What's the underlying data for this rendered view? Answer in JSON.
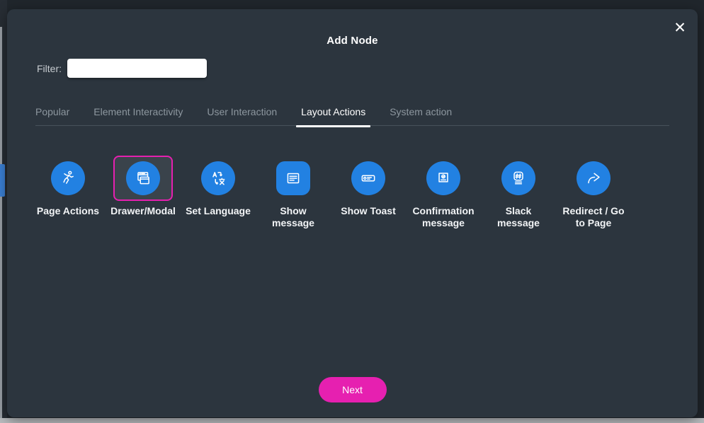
{
  "modal": {
    "title": "Add Node",
    "close_glyph": "✕",
    "filter": {
      "label": "Filter:",
      "value": "",
      "placeholder": ""
    },
    "tabs": [
      {
        "label": "Popular",
        "active": false
      },
      {
        "label": "Element Interactivity",
        "active": false
      },
      {
        "label": "User Interaction",
        "active": false
      },
      {
        "label": "Layout Actions",
        "active": true
      },
      {
        "label": "System action",
        "active": false
      }
    ],
    "nodes": [
      {
        "label": "Page Actions",
        "icon": "running-person-icon",
        "selected": false,
        "badge_shape": "circle"
      },
      {
        "label": "Drawer/Modal",
        "icon": "drawer-window-icon",
        "selected": true,
        "badge_shape": "circle"
      },
      {
        "label": "Set Language",
        "icon": "translate-icon",
        "selected": false,
        "badge_shape": "circle"
      },
      {
        "label": "Show\nmessage",
        "icon": "message-lines-icon",
        "selected": false,
        "badge_shape": "rounded-square"
      },
      {
        "label": "Show Toast",
        "icon": "toast-bar-icon",
        "selected": false,
        "badge_shape": "circle"
      },
      {
        "label": "Confirmation\nmessage",
        "icon": "confirm-dialog-icon",
        "selected": false,
        "badge_shape": "circle"
      },
      {
        "label": "Slack\nmessage",
        "icon": "slack-hash-icon",
        "selected": false,
        "badge_shape": "circle"
      },
      {
        "label": "Redirect / Go\nto Page",
        "icon": "redirect-arrow-icon",
        "selected": false,
        "badge_shape": "circle"
      }
    ],
    "next_button_label": "Next"
  },
  "colors": {
    "modal_background": "#2c353e",
    "accent_blue": "#2281e2",
    "accent_pink": "#e620b0",
    "tab_inactive": "#8d979f",
    "tab_active": "#ffffff",
    "selected_tile_background": "#3a434b"
  }
}
